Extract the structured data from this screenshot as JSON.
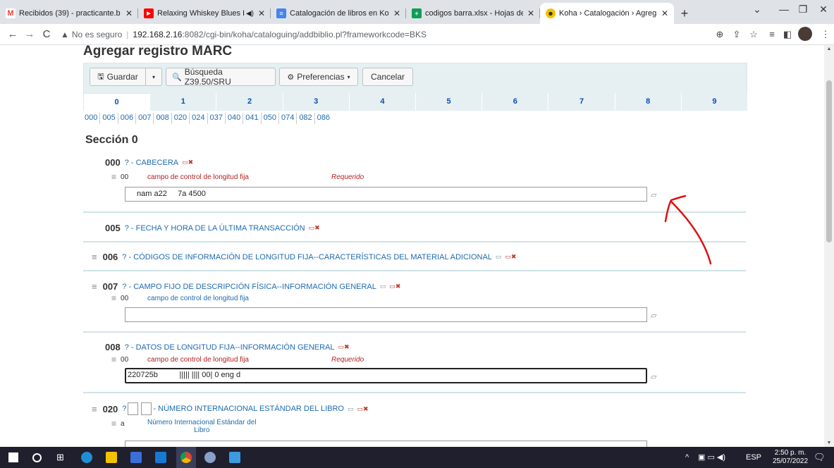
{
  "browser": {
    "tabs": [
      {
        "title": "Recibidos (39) - practicante.b",
        "favicon": "gmail-icon",
        "color": "#ea4335",
        "glyph": "M",
        "active": false
      },
      {
        "title": "Relaxing Whiskey Blues I",
        "favicon": "youtube-icon",
        "color": "#ff0000",
        "glyph": "▶",
        "active": false
      },
      {
        "title": "Catalogación de libros en Ko",
        "favicon": "docs-icon",
        "color": "#4285f4",
        "glyph": "≡",
        "active": false
      },
      {
        "title": "codigos barra.xlsx - Hojas de",
        "favicon": "sheets-icon",
        "color": "#0f9d58",
        "glyph": "▦",
        "active": false
      },
      {
        "title": "Koha › Catalogación › Agrega",
        "favicon": "koha-icon",
        "color": "#3a3a3a",
        "glyph": "☻",
        "active": true
      }
    ],
    "new_tab": "+",
    "address": {
      "warning": "No es seguro",
      "host": "192.168.2.16",
      "path": ":8082/cgi-bin/koha/cataloguing/addbiblio.pl?frameworkcode=BKS"
    }
  },
  "page": {
    "title": "Agregar registro MARC",
    "toolbar": {
      "save": "Guardar",
      "z3950": "Búsqueda Z39.50/SRU",
      "prefs": "Preferencias",
      "cancel": "Cancelar"
    },
    "tabs": [
      "0",
      "1",
      "2",
      "3",
      "4",
      "5",
      "6",
      "7",
      "8",
      "9"
    ],
    "field_links": [
      "000",
      "005",
      "006",
      "007",
      "008",
      "020",
      "024",
      "037",
      "040",
      "041",
      "050",
      "074",
      "082",
      "086"
    ],
    "section": "Sección 0",
    "fields": {
      "f000": {
        "tag": "000",
        "label": "? - CABECERA",
        "sub_code": "00",
        "sub_desc": "campo de control de longitud fija",
        "required": "Requerido",
        "value": "nam a22     7a 4500"
      },
      "f005": {
        "tag": "005",
        "label": "? - FECHA Y HORA DE LA ÚLTIMA TRANSACCIÓN"
      },
      "f006": {
        "tag": "006",
        "label": "? - CÓDIGOS DE INFORMACIÓN DE LONGITUD FIJA--CARACTERÍSTICAS DEL MATERIAL ADICIONAL"
      },
      "f007": {
        "tag": "007",
        "label": "? - CAMPO FIJO DE DESCRIPCIÓN FÍSICA--INFORMACIÓN GENERAL",
        "sub_code": "00",
        "sub_desc": "campo de control de longitud fija",
        "value": ""
      },
      "f008": {
        "tag": "008",
        "label": "? - DATOS DE LONGITUD FIJA--INFORMACIÓN GENERAL",
        "sub_code": "00",
        "sub_desc": "campo de control de longitud fija",
        "required": "Requerido",
        "value": "220725b          ||||| |||| 00| 0 eng d"
      },
      "f020": {
        "tag": "020",
        "label_q": "?",
        "label": "- NÚMERO INTERNACIONAL ESTÁNDAR DEL LIBRO",
        "sub_code": "a",
        "sub_desc_line1": "Número Internacional Estándar del",
        "sub_desc_line2": "Libro"
      }
    }
  },
  "taskbar": {
    "lang": "ESP",
    "time": "2:50 p. m.",
    "date": "25/07/2022"
  },
  "colors": {
    "annotation_arrow": "#e01010",
    "link": "#1e6bb0",
    "required": "#b41e1e"
  }
}
